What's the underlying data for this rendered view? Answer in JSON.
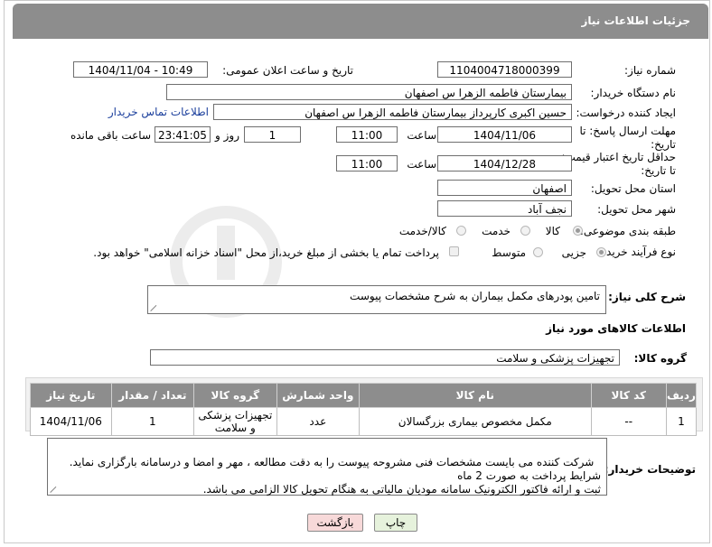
{
  "header": {
    "title": "جزئیات اطلاعات نیاز"
  },
  "labels": {
    "need_number": "شماره نیاز:",
    "public_date": "تاریخ و ساعت اعلان عمومی:",
    "buyer_org": "نام دستگاه خریدار:",
    "requester": "ایجاد کننده درخواست:",
    "reply_deadline": "مهلت ارسال پاسخ: تا تاریخ:",
    "price_deadline": "حداقل تاریخ اعتبار قیمت: تا تاریخ:",
    "time": "ساعت",
    "day_and": "روز و",
    "remaining": "ساعت باقی مانده",
    "province": "استان محل تحویل:",
    "city": "شهر محل تحویل:",
    "category": "طبقه بندی موضوعی:",
    "process_type": "نوع فرآیند خرید :",
    "description": "شرح کلی نیاز:",
    "goods_info": "اطلاعات کالاهای مورد نیاز",
    "goods_group": "گروه کالا:",
    "buyer_notes": "توضیحات خریدار:"
  },
  "fields": {
    "need_number": "1104004718000399",
    "public_date": "1404/11/04 - 10:49",
    "buyer_org": "بیمارستان فاطمه الزهرا س  اصفهان",
    "requester": "حسین اکبری کارپرداز بیمارستان فاطمه الزهرا س  اصفهان",
    "contact_link": "اطلاعات تماس خریدار",
    "reply_date": "1404/11/06",
    "reply_time": "11:00",
    "reply_days": "1",
    "reply_remaining": "23:41:05",
    "price_date": "1404/12/28",
    "price_time": "11:00",
    "province": "اصفهان",
    "city": "نجف آباد",
    "description": "تامین پودرهای مکمل بیماران به شرح مشخصات پیوست",
    "goods_group": "تجهیزات پزشکی و سلامت",
    "buyer_notes": "شرکت کننده می بایست مشخصات فنی مشروحه پیوست را به دقت مطالعه ، مهر و امضا و درسامانه بارگزاری نماید. شرایط پرداخت به صورت 2 ماه\nثبت و ارائه فاکتور الکترونیک سامانه مودیان مالیاتی به هنگام تحویل کالا الزامی می باشد."
  },
  "category_options": [
    {
      "label": "کالا",
      "selected": true
    },
    {
      "label": "خدمت",
      "selected": false
    },
    {
      "label": "کالا/خدمت",
      "selected": false
    }
  ],
  "process_options": [
    {
      "label": "جزیی",
      "selected": true
    },
    {
      "label": "متوسط",
      "selected": false
    }
  ],
  "process_note": "پرداخت تمام یا بخشی از مبلغ خرید،از محل \"اسناد خزانه اسلامی\" خواهد بود.",
  "table": {
    "headers": [
      "ردیف",
      "کد کالا",
      "نام کالا",
      "واحد شمارش",
      "گروه کالا",
      "تعداد / مقدار",
      "تاریخ نیاز"
    ],
    "rows": [
      [
        "1",
        "--",
        "مکمل مخصوص بیماری بزرگسالان",
        "عدد",
        "تجهیزات پزشکی و سلامت",
        "1",
        "1404/11/06"
      ]
    ]
  },
  "buttons": {
    "print": "چاپ",
    "back": "بازگشت"
  },
  "colors": {
    "header_bg": "#8d8d8d",
    "link": "#1b3f9c",
    "back_btn_bg": "#f7d9d9",
    "print_btn_bg": "#e6f2dc"
  }
}
